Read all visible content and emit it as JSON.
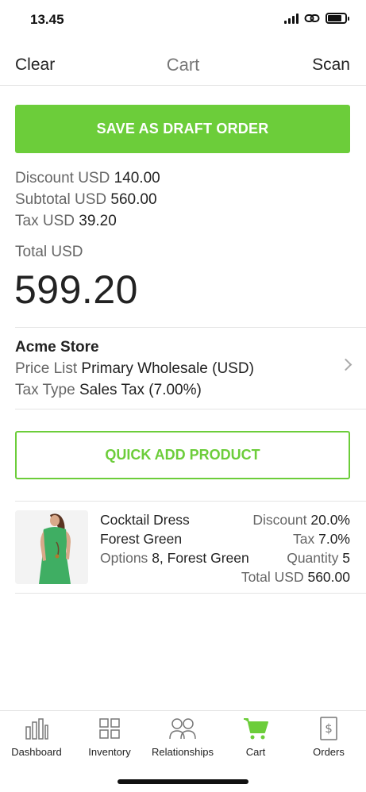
{
  "status_bar": {
    "time": "13.45"
  },
  "nav": {
    "left": "Clear",
    "title": "Cart",
    "right": "Scan"
  },
  "actions": {
    "save_draft": "SAVE AS DRAFT ORDER",
    "quick_add": "QUICK ADD PRODUCT"
  },
  "summary": {
    "discount_label": "Discount",
    "discount_currency": "USD",
    "discount_value": "140.00",
    "subtotal_label": "Subtotal",
    "subtotal_currency": "USD",
    "subtotal_value": "560.00",
    "tax_label": "Tax",
    "tax_currency": "USD",
    "tax_value": "39.20",
    "total_label": "Total USD",
    "total_value": "599.20"
  },
  "store": {
    "name": "Acme Store",
    "price_list_label": "Price List",
    "price_list_value": "Primary Wholesale (USD)",
    "tax_type_label": "Tax Type",
    "tax_type_value": "Sales Tax (7.00%)"
  },
  "cart_items": [
    {
      "name": "Cocktail Dress",
      "variant": "Forest Green",
      "options_label": "Options",
      "options_value": "8, Forest Green",
      "discount_label": "Discount",
      "discount_value": "20.0%",
      "tax_label": "Tax",
      "tax_value": "7.0%",
      "quantity_label": "Quantity",
      "quantity_value": "5",
      "total_label": "Total USD",
      "total_value": "560.00"
    }
  ],
  "tabs": [
    {
      "label": "Dashboard",
      "icon": "bar-chart-icon"
    },
    {
      "label": "Inventory",
      "icon": "grid-icon"
    },
    {
      "label": "Relationships",
      "icon": "people-icon"
    },
    {
      "label": "Cart",
      "icon": "cart-icon",
      "active": true
    },
    {
      "label": "Orders",
      "icon": "receipt-icon"
    }
  ],
  "colors": {
    "accent": "#6ccd3a",
    "muted_text": "#666666",
    "divider": "#e4e4e4"
  }
}
